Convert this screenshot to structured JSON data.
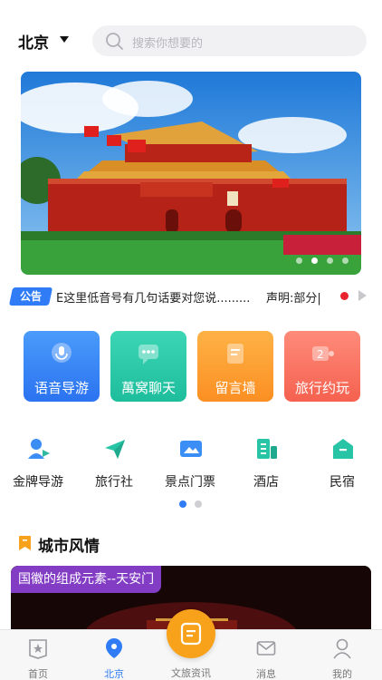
{
  "header": {
    "city": "北京",
    "search_placeholder": "搜索你想要的"
  },
  "banner": {
    "slide_count": 4,
    "active_slide": 2
  },
  "notice": {
    "badge": "公告",
    "text": "E这里低音号有几句话要对您说.........",
    "text2": "声明:部分|"
  },
  "tiles": [
    {
      "label": "语音导游",
      "icon": "voice-guide-icon",
      "color_top": "#4a9bfb",
      "color_bottom": "#2b73f0"
    },
    {
      "label": "萬窝聊天",
      "icon": "chat-icon",
      "color_top": "#3cd6b5",
      "color_bottom": "#1ebd9c"
    },
    {
      "label": "留言墙",
      "icon": "message-wall-icon",
      "color_top": "#ffb246",
      "color_bottom": "#fb8f23"
    },
    {
      "label": "旅行约玩",
      "icon": "travel-meet-icon",
      "color_top": "#ff8b7a",
      "color_bottom": "#f5614f"
    }
  ],
  "grid": [
    {
      "label": "金牌导游",
      "icon": "guide-person-icon"
    },
    {
      "label": "旅行社",
      "icon": "paper-plane-icon"
    },
    {
      "label": "景点门票",
      "icon": "ticket-image-icon"
    },
    {
      "label": "酒店",
      "icon": "hotel-building-icon"
    },
    {
      "label": "民宿",
      "icon": "homestay-house-icon"
    }
  ],
  "grid_pages": 2,
  "grid_active_page": 1,
  "section": {
    "title": "城市风情",
    "card_tag": "国徽的组成元素--天安门"
  },
  "tabbar": {
    "items": [
      {
        "label": "首页",
        "icon": "home-star-icon"
      },
      {
        "label": "北京",
        "icon": "location-pin-icon"
      },
      {
        "label": "文旅资讯",
        "icon": "news-doc-icon"
      },
      {
        "label": "消息",
        "icon": "mail-icon"
      },
      {
        "label": "我的",
        "icon": "profile-icon"
      }
    ],
    "active": "北京"
  },
  "colors": {
    "accent": "#2f7cf6",
    "icon_blue": "#3a8ef6",
    "icon_teal": "#27c4a6",
    "center_button": "#f7a21a",
    "notice_dot": "#e8222f"
  }
}
